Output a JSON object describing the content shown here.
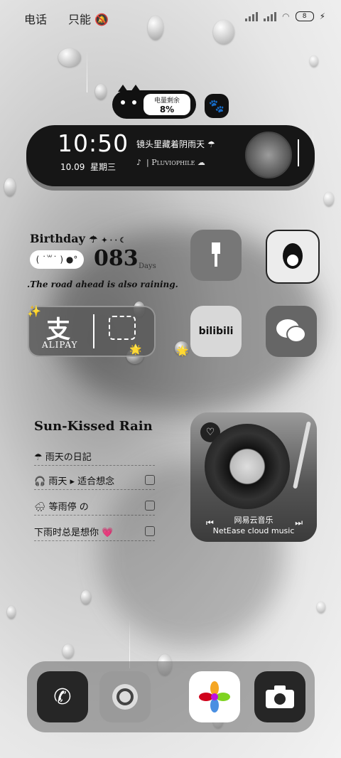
{
  "status_bar": {
    "carrier_left": "电话",
    "carrier_right": "只能",
    "battery": "8"
  },
  "cat_widget": {
    "battery_label": "电量剩余",
    "battery_value": "8%"
  },
  "clock_widget": {
    "time": "10:50",
    "date": "10.09",
    "weekday": "星期三",
    "song_title": "镜头里藏着阴雨天",
    "artist": "Pluviophile"
  },
  "birthday_widget": {
    "title": "Birthday",
    "countdown": "083",
    "unit": "Days",
    "caption": ".The road ahead is also raining."
  },
  "alipay_widget": {
    "glyph": "支",
    "name": "ALIPAY"
  },
  "app_icons": [
    {
      "name": "brush"
    },
    {
      "name": "qq"
    },
    {
      "name": "bilibili",
      "label": "bilibili"
    },
    {
      "name": "wechat"
    }
  ],
  "todo_widget": {
    "title": "Sun-Kissed Rain",
    "items": [
      "雨天の日記",
      "雨天 ▸ 适合想念",
      "等雨停  の",
      "下雨时总是想你"
    ]
  },
  "music_widget": {
    "name_cn": "网易云音乐",
    "name_en": "NetEase cloud music"
  },
  "dock": [
    {
      "name": "phone"
    },
    {
      "name": "camera-round"
    },
    {
      "name": "photos"
    },
    {
      "name": "camera"
    }
  ]
}
